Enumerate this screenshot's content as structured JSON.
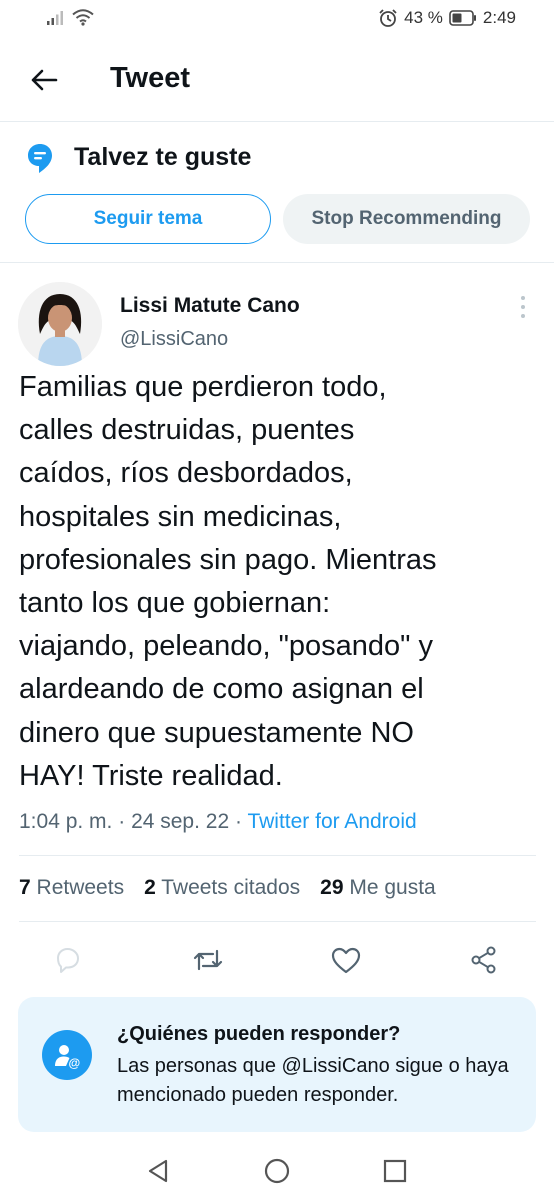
{
  "status_bar": {
    "battery_percent": "43 %",
    "time": "2:49",
    "icons": [
      "signal-icon",
      "wifi-icon",
      "alarm-icon",
      "battery-icon"
    ]
  },
  "header": {
    "title": "Tweet",
    "back_icon": "arrow-left-icon"
  },
  "topic": {
    "title": "Talvez te guste",
    "icon": "topic-icon",
    "follow_label": "Seguir tema",
    "stop_label": "Stop Recommending"
  },
  "tweet": {
    "author_name": "Lissi Matute Cano",
    "author_handle": "@LissiCano",
    "text_lines": [
      "Familias que perdieron todo,",
      "calles destruidas, puentes",
      "caídos, ríos desbordados,",
      "hospitales sin medicinas,",
      "profesionales sin pago. Mientras",
      "tanto los que gobiernan:",
      "viajando, peleando, \"posando\" y",
      "alardeando de como asignan el",
      "dinero que supuestamente NO",
      "HAY! Triste realidad."
    ],
    "time": "1:04 p. m.",
    "date": "24 sep. 22",
    "client": "Twitter for Android",
    "separator": " · "
  },
  "stats": {
    "retweets_count": "7",
    "retweets_label": "Retweets",
    "quotes_count": "2",
    "quotes_label": "Tweets citados",
    "likes_count": "29",
    "likes_label": "Me gusta"
  },
  "actions": [
    "reply-icon",
    "retweet-icon",
    "like-icon",
    "share-icon"
  ],
  "reply_settings": {
    "title": "¿Quiénes pueden responder?",
    "body": "Las personas que @LissiCano sigue o haya mencionado pueden responder."
  },
  "colors": {
    "accent": "#1d9bf0",
    "text": "#0f1419",
    "secondary_text": "#536471",
    "card_bg": "#e8f5fd",
    "stop_bg": "#eff3f4"
  }
}
